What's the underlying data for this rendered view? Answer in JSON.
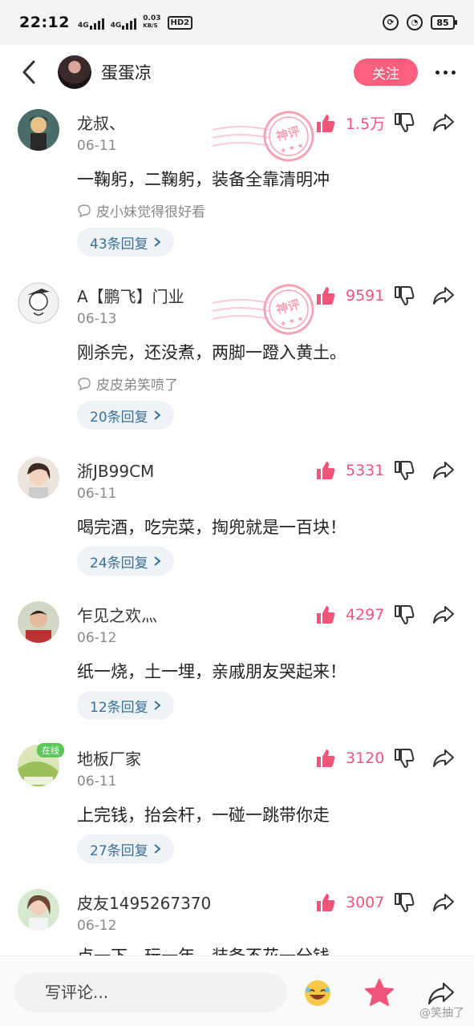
{
  "status_bar": {
    "time": "22:12",
    "network_1": "4G",
    "network_2": "4G",
    "speed_value": "0.03",
    "speed_unit": "KB/S",
    "hd_label": "HD2",
    "battery": "85"
  },
  "header": {
    "title": "蛋蛋凉",
    "follow_label": "关注"
  },
  "stamp_text": "神评",
  "comments": [
    {
      "user": "龙叔、",
      "date": "06-11",
      "likes": "1.5万",
      "text": "一鞠躬，二鞠躬，装备全靠清明冲",
      "reaction": "皮小妹觉得很好看",
      "replies": "43条回复",
      "highlighted": true
    },
    {
      "user": "A【鹏飞】门业",
      "date": "06-13",
      "likes": "9591",
      "text": "刚杀完，还没煮，两脚一蹬入黄土。",
      "reaction": "皮皮弟笑喷了",
      "replies": "20条回复",
      "highlighted": true
    },
    {
      "user": "浙JB99CM",
      "date": "06-11",
      "likes": "5331",
      "text": "喝完酒，吃完菜，掏兜就是一百块！",
      "reaction": "",
      "replies": "24条回复",
      "highlighted": false
    },
    {
      "user": "乍见之欢灬",
      "date": "06-12",
      "likes": "4297",
      "text": "纸一烧，土一埋，亲戚朋友哭起来！",
      "reaction": "",
      "replies": "12条回复",
      "highlighted": false
    },
    {
      "user": "地板厂家",
      "date": "06-11",
      "likes": "3120",
      "text": "上完钱，抬会杆，一碰一跳带你走",
      "reaction": "",
      "replies": "27条回复",
      "highlighted": false,
      "badge": "在线"
    },
    {
      "user": "皮友1495267370",
      "date": "06-12",
      "likes": "3007",
      "text": "点一下，玩一年，装备不花一分钱",
      "reaction": "",
      "replies": "",
      "highlighted": false
    }
  ],
  "bottom_bar": {
    "comment_placeholder": "写评论...",
    "watermark": "@笑抽了"
  },
  "colors": {
    "accent": "#ff5e7f",
    "like": "#f0547a",
    "reply_text": "#3e6f95",
    "reply_bg": "#eef3f6"
  },
  "icons": [
    "back-icon",
    "more-icon",
    "like-icon",
    "dislike-icon",
    "share-icon",
    "reaction-icon",
    "chevron-right-icon",
    "emoji-icon",
    "star-icon"
  ]
}
